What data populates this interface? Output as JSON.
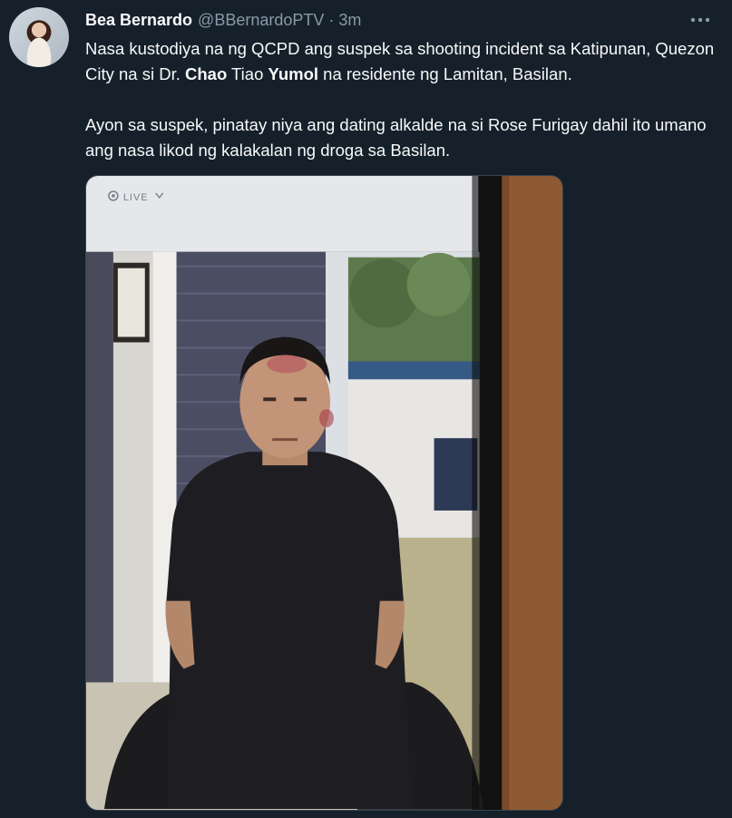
{
  "author": {
    "display_name": "Bea Bernardo",
    "handle": "@BBernardoPTV",
    "separator": "·",
    "time": "3m"
  },
  "tweet": {
    "p1_a": "Nasa kustodiya na ng QCPD ang suspek sa shooting incident sa Katipunan, Quezon City na si Dr. ",
    "p1_b": "Chao",
    "p1_c": " Tiao ",
    "p1_d": "Yumol",
    "p1_e": " na residente ng Lamitan, Basilan.",
    "p2": "Ayon sa suspek, pinatay niya ang dating alkalde na si Rose Furigay dahil ito umano ang nasa likod ng kalakalan ng droga sa Basilan."
  },
  "media": {
    "live_label": "LIVE"
  },
  "icons": {
    "more": "more-horizontal-icon",
    "live": "live-icon",
    "chevron": "chevron-down-icon"
  },
  "colors": {
    "background": "#15202b",
    "text_primary": "#f7f9f9",
    "text_secondary": "#8b98a5"
  }
}
